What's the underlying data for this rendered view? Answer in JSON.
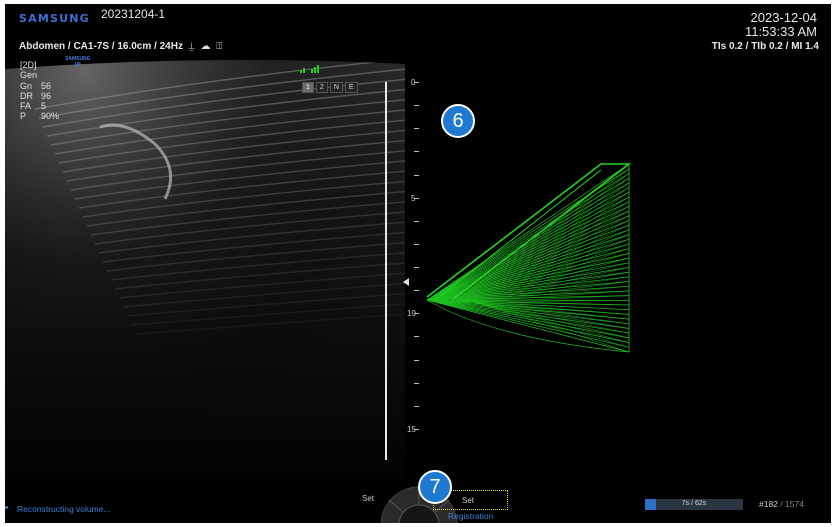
{
  "header": {
    "brand": "SAMSUNG",
    "patient_id": "20231204-1",
    "date": "2023-12-04",
    "time": "11:53:33 AM",
    "probe_info": "Abdomen / CA1-7S / 16.0cm / 24Hz",
    "probe_icons": [
      "probe-icon",
      "power-doppler-icon",
      "hand-icon"
    ],
    "thermal_index": "TIs  0.2 / TIb  0.2 / MI    1.4",
    "small_logo_line1": "SAMSUNG",
    "small_logo_line2": "V8"
  },
  "params": [
    {
      "k": "[2D]",
      "v": ""
    },
    {
      "k": "Gen",
      "v": ""
    },
    {
      "k": "Gn",
      "v": "56"
    },
    {
      "k": "DR",
      "v": "96"
    },
    {
      "k": "FA",
      "v": "5"
    },
    {
      "k": "P",
      "v": "90%"
    }
  ],
  "mode_tabs": [
    "1",
    "2",
    "N",
    "E"
  ],
  "active_tab": "1",
  "depth_scale": {
    "labels": [
      {
        "text": "0",
        "value": 0
      },
      {
        "text": "5",
        "value": 5
      },
      {
        "text": "10",
        "value": 10
      },
      {
        "text": "15",
        "value": 15
      }
    ],
    "max": 16
  },
  "annotations": {
    "badge_top": "6",
    "badge_bottom": "7"
  },
  "status": {
    "reconstructing": "Reconstructing volume...",
    "set_left": "Set",
    "set_button": "Set",
    "registration": "Registration"
  },
  "progress": {
    "text": "7s / 62s",
    "fraction": 0.113
  },
  "frames": {
    "current": "#182",
    "total": "/ 1574"
  },
  "colors": {
    "brand": "#3d6fd6",
    "status_blue": "#3b82d6",
    "wireframe_green": "#1fbf1f",
    "highlight_yellow": "#f2e21a",
    "badge_blue": "#1f78d1"
  }
}
